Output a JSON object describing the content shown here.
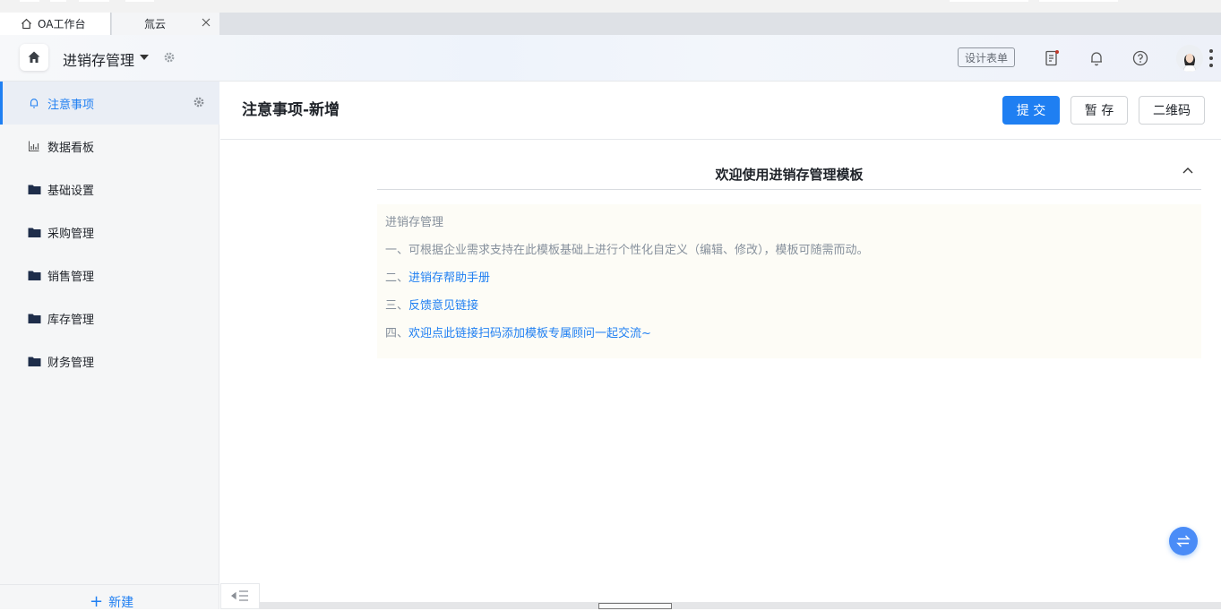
{
  "browser_tabs": [
    {
      "label": "OA工作台",
      "icon": "home-outline-icon"
    },
    {
      "label": "氚云",
      "close_icon": "close-icon"
    }
  ],
  "header": {
    "app_title": "进销存管理",
    "design_button": "设计表单",
    "icons": [
      "home-icon",
      "dropdown-caret-icon",
      "settings-gear-icon",
      "task-list-icon",
      "bell-icon",
      "help-icon",
      "user-avatar",
      "more-vertical-icon"
    ]
  },
  "sidebar": {
    "items": [
      {
        "label": "注意事项",
        "icon": "bell-icon",
        "active": true
      },
      {
        "label": "数据看板",
        "icon": "bar-chart-icon"
      },
      {
        "label": "基础设置",
        "icon": "folder-icon"
      },
      {
        "label": "采购管理",
        "icon": "folder-icon"
      },
      {
        "label": "销售管理",
        "icon": "folder-icon"
      },
      {
        "label": "库存管理",
        "icon": "folder-icon"
      },
      {
        "label": "财务管理",
        "icon": "folder-icon"
      }
    ],
    "new_label": "新建"
  },
  "main": {
    "title": "注意事项-新增",
    "buttons": {
      "submit": "提 交",
      "save": "暂 存",
      "qrcode": "二维码"
    },
    "section_title": "欢迎使用进销存管理模板",
    "notice": {
      "heading": "进销存管理",
      "line1": "一、可根据企业需求支持在此模板基础上进行个性化自定义（编辑、修改），模板可随需而动。",
      "line2_prefix": "二、",
      "line2_link": "进销存帮助手册",
      "line3_prefix": "三、",
      "line3_link": "反馈意见链接",
      "line4_prefix": "四、",
      "line4_link": "欢迎点此链接扫码添加模板专属顾问一起交流~"
    }
  },
  "colors": {
    "accent": "#1f7ff2",
    "notice_bg": "#fdfcf6",
    "sidebar_bg": "#f5f6f7"
  }
}
